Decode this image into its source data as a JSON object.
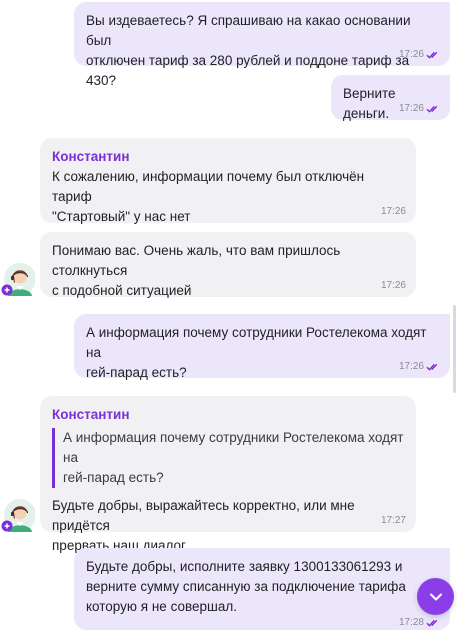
{
  "colors": {
    "outgoing_bubble": "#ece6fb",
    "incoming_bubble": "#f1f1f4",
    "accent": "#7b2fd6",
    "read_ticks": "#7b2fd6",
    "scroll_button": "#8b3ee8"
  },
  "messages": [
    {
      "direction": "out",
      "text": "Вы издеваетесь? Я спрашиваю на какао основании был\nотключен тариф за 280 рублей и поддоне тариф за 430?",
      "time": "17:26",
      "status": "read"
    },
    {
      "direction": "out",
      "text": "Верните деньги.",
      "time": "17:26",
      "status": "read"
    },
    {
      "direction": "in",
      "author": "Константин",
      "text": "К сожалению, информации почему был отключён тариф\n\"Стартовый\" у нас нет",
      "time": "17:26"
    },
    {
      "direction": "in",
      "text": "Понимаю вас. Очень жаль, что вам пришлось столкнуться\nс подобной ситуацией",
      "time": "17:26"
    },
    {
      "direction": "out",
      "text": "А информация почему сотрудники Ростелекома ходят на\nгей-парад есть?",
      "time": "17:26",
      "status": "read"
    },
    {
      "direction": "in",
      "author": "Константин",
      "quote": "А информация почему сотрудники Ростелекома ходят на\nгей-парад есть?",
      "text": "Будьте добры, выражайтесь корректно, или мне придётся\nпрервать наш диалог.",
      "time": "17:27"
    },
    {
      "direction": "out",
      "text": "Будьте добры, исполните заявку 1300133061293 и\nверните сумму списанную за подключение тарифа\nкоторую я не совершал.",
      "time": "17:28",
      "status": "read"
    }
  ],
  "icons": {
    "agent_avatar": "operator-avatar-icon",
    "read_status": "double-check-icon",
    "scroll_down": "chevron-down-icon"
  }
}
